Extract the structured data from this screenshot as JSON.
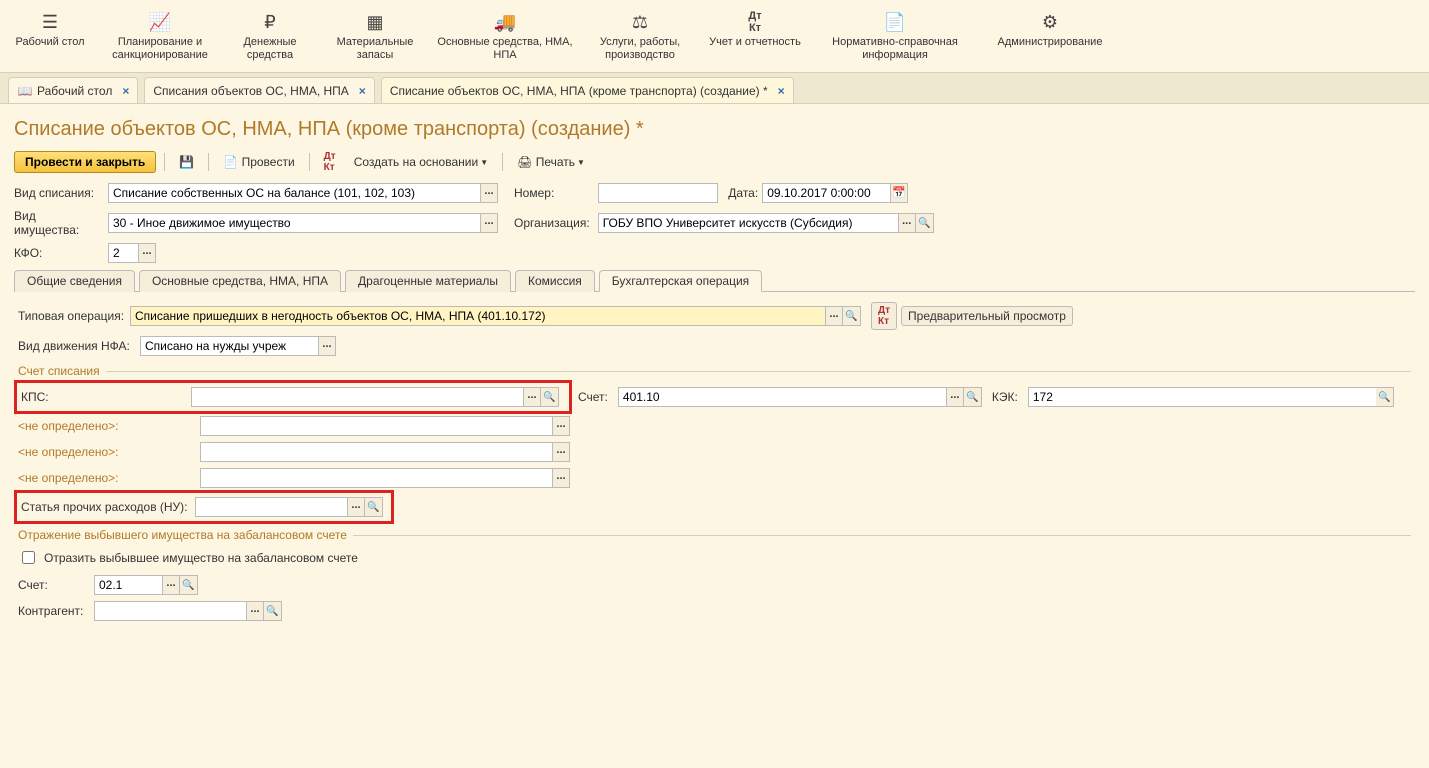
{
  "topnav": [
    {
      "label": "Рабочий стол"
    },
    {
      "label": "Планирование и санкционирование"
    },
    {
      "label": "Денежные средства"
    },
    {
      "label": "Материальные запасы"
    },
    {
      "label": "Основные средства, НМА, НПА"
    },
    {
      "label": "Услуги, работы, производство"
    },
    {
      "label": "Учет и отчетность"
    },
    {
      "label": "Нормативно-справочная информация"
    },
    {
      "label": "Администрирование"
    }
  ],
  "apptabs": [
    {
      "label": "Рабочий стол"
    },
    {
      "label": "Списания объектов ОС, НМА, НПА"
    },
    {
      "label": "Списание объектов ОС, НМА, НПА (кроме транспорта) (создание) *",
      "active": true
    }
  ],
  "pageTitle": "Списание объектов ОС, НМА, НПА (кроме транспорта) (создание) *",
  "toolbar": {
    "primary": "Провести и закрыть",
    "provesti": "Провести",
    "createBased": "Создать на основании",
    "print": "Печать"
  },
  "labels": {
    "vidSpis": "Вид списания:",
    "vidIm": "Вид имущества:",
    "kfo": "КФО:",
    "nomer": "Номер:",
    "data": "Дата:",
    "org": "Организация:",
    "typop": "Типовая операция:",
    "vidDvNfa": "Вид движения НФА:",
    "kps": "КПС:",
    "schet": "Счет:",
    "kek": "КЭК:",
    "statya": "Статья прочих расходов (НУ):",
    "schet2": "Счет:",
    "kontr": "Контрагент:",
    "undef": "<не определено>:",
    "fsSchet": "Счет списания",
    "fsOtr": "Отражение выбывшего имущества на забалансовом счете",
    "chkOtr": "Отразить выбывшее имущество на забалансовом счете",
    "preview": "Предварительный просмотр"
  },
  "values": {
    "vidSpis": "Списание собственных ОС на балансе (101, 102, 103)",
    "vidIm": "30 - Иное движимое имущество",
    "kfo": "2",
    "nomer": "",
    "data": "09.10.2017 0:00:00",
    "org": "ГОБУ ВПО Университет искусств (Субсидия)",
    "typop": "Списание пришедших в негодность объектов ОС, НМА, НПА (401.10.172)",
    "vidDvNfa": "Списано на нужды учреж",
    "kps": "",
    "schet": "401.10",
    "kek": "172",
    "statya": "",
    "schet2": "02.1",
    "kontr": ""
  },
  "subtabs": [
    "Общие сведения",
    "Основные средства, НМА, НПА",
    "Драгоценные материалы",
    "Комиссия",
    "Бухгалтерская операция"
  ],
  "activeSubtab": 4
}
